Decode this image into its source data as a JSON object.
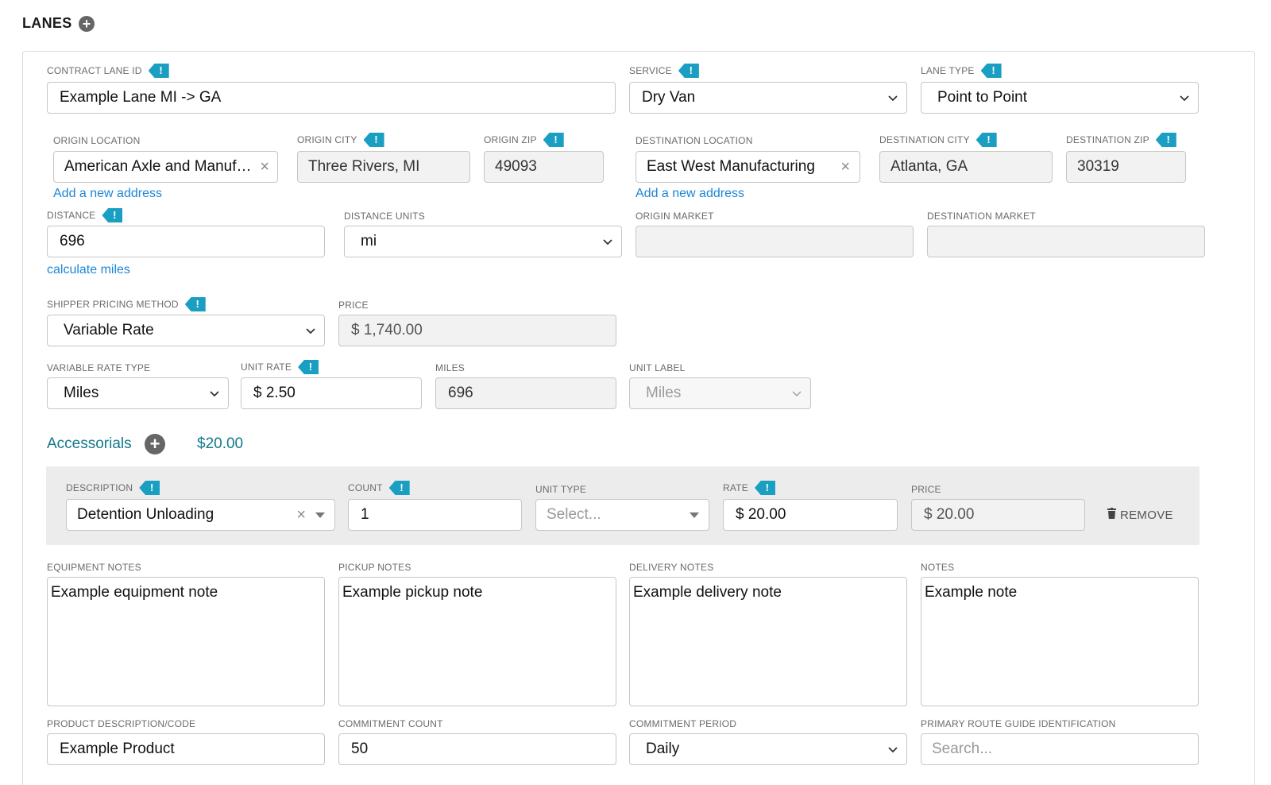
{
  "section": {
    "title": "LANES"
  },
  "fields": {
    "contract_lane_id": {
      "label": "CONTRACT LANE ID",
      "value": "Example Lane MI -> GA"
    },
    "service": {
      "label": "SERVICE",
      "value": "Dry Van"
    },
    "lane_type": {
      "label": "LANE TYPE",
      "value": "Point to Point"
    },
    "origin_location": {
      "label": "ORIGIN LOCATION",
      "value": "American Axle and Manufact..",
      "link": "Add a new address"
    },
    "origin_city": {
      "label": "ORIGIN CITY",
      "value": "Three Rivers, MI"
    },
    "origin_zip": {
      "label": "ORIGIN ZIP",
      "value": "49093"
    },
    "destination_location": {
      "label": "DESTINATION LOCATION",
      "value": "East West Manufacturing",
      "link": "Add a new address"
    },
    "destination_city": {
      "label": "DESTINATION CITY",
      "value": "Atlanta, GA"
    },
    "destination_zip": {
      "label": "DESTINATION ZIP",
      "value": "30319"
    },
    "distance": {
      "label": "DISTANCE",
      "value": "696",
      "link": "calculate miles"
    },
    "distance_units": {
      "label": "DISTANCE UNITS",
      "value": "mi"
    },
    "origin_market": {
      "label": "ORIGIN MARKET",
      "value": ""
    },
    "destination_market": {
      "label": "DESTINATION MARKET",
      "value": ""
    },
    "shipper_pricing_method": {
      "label": "SHIPPER PRICING METHOD",
      "value": "Variable Rate"
    },
    "price": {
      "label": "PRICE",
      "value": "$ 1,740.00"
    },
    "variable_rate_type": {
      "label": "VARIABLE RATE TYPE",
      "value": "Miles"
    },
    "unit_rate": {
      "label": "UNIT RATE",
      "value": "$ 2.50"
    },
    "miles": {
      "label": "MILES",
      "value": "696"
    },
    "unit_label": {
      "label": "UNIT LABEL",
      "value": "Miles"
    }
  },
  "accessorials": {
    "title": "Accessorials",
    "total": "$20.00",
    "row": {
      "description": {
        "label": "DESCRIPTION",
        "value": "Detention Unloading"
      },
      "count": {
        "label": "COUNT",
        "value": "1"
      },
      "unit_type": {
        "label": "UNIT TYPE",
        "placeholder": "Select..."
      },
      "rate": {
        "label": "RATE",
        "value": "$ 20.00"
      },
      "price": {
        "label": "PRICE",
        "value": "$ 20.00"
      },
      "remove_label": "REMOVE"
    }
  },
  "notes": {
    "equipment": {
      "label": "EQUIPMENT NOTES",
      "value": "Example equipment note"
    },
    "pickup": {
      "label": "PICKUP NOTES",
      "value": "Example pickup note"
    },
    "delivery": {
      "label": "DELIVERY NOTES",
      "value": "Example delivery note"
    },
    "general": {
      "label": "NOTES",
      "value": "Example note"
    }
  },
  "bottom": {
    "product": {
      "label": "PRODUCT DESCRIPTION/CODE",
      "value": "Example Product"
    },
    "commitment_count": {
      "label": "COMMITMENT COUNT",
      "value": "50"
    },
    "commitment_period": {
      "label": "COMMITMENT PERIOD",
      "value": "Daily"
    },
    "route_guide": {
      "label": "PRIMARY ROUTE GUIDE IDENTIFICATION",
      "placeholder": "Search..."
    }
  },
  "icons": {
    "flag": "!",
    "plus": "+",
    "clear": "×"
  },
  "colors": {
    "flag": "#1a9fc2",
    "link": "#1a86d9",
    "accent": "#137a8c"
  }
}
